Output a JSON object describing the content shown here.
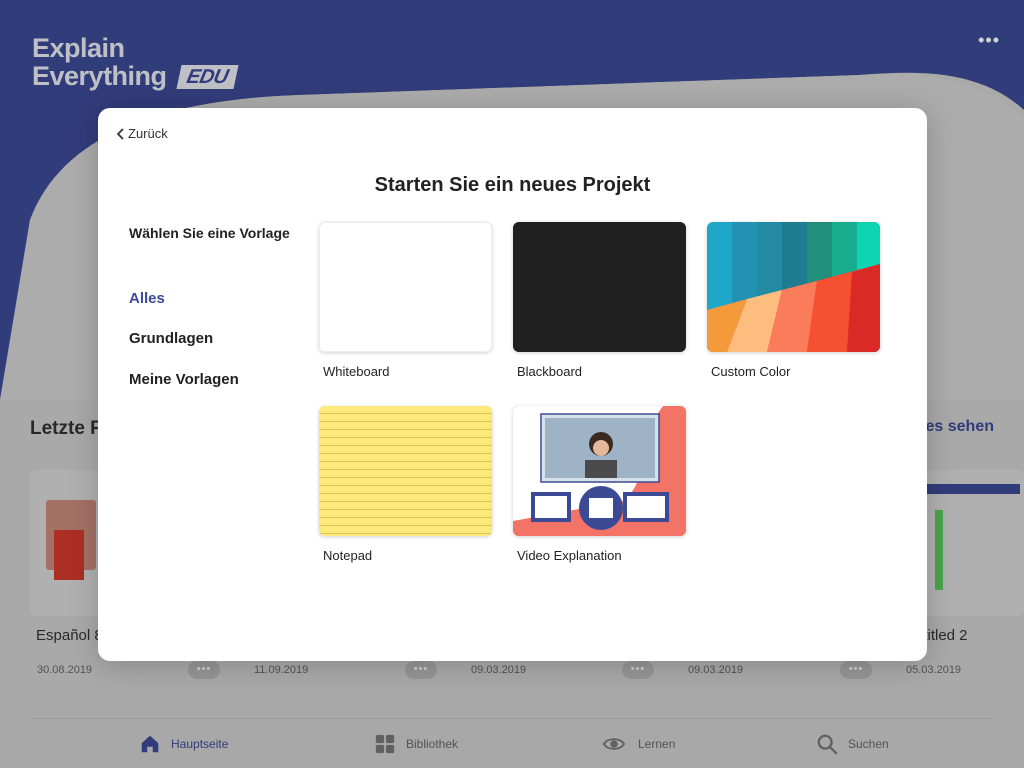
{
  "app": {
    "logo_line1": "Explain",
    "logo_line2": "Everything",
    "logo_badge": "EDU",
    "more_menu": "•••",
    "brand_color": "#3c4a95"
  },
  "recent": {
    "title": "Letzte P",
    "see_all": "es sehen",
    "projects": [
      {
        "name": "Español 8",
        "date": "30.08.2019"
      },
      {
        "name": "",
        "date": "11.09.2019"
      },
      {
        "name": "",
        "date": "09.03.2019"
      },
      {
        "name": "",
        "date": "09.03.2019"
      },
      {
        "name": "ititled 2",
        "date": "05.03.2019"
      }
    ]
  },
  "tabs": [
    {
      "label": "Hauptseite",
      "icon": "home-icon",
      "active": true
    },
    {
      "label": "Bibliothek",
      "icon": "grid-icon",
      "active": false
    },
    {
      "label": "Lernen",
      "icon": "eye-icon",
      "active": false
    },
    {
      "label": "Suchen",
      "icon": "search-icon",
      "active": false
    }
  ],
  "modal": {
    "back_label": "Zurück",
    "title": "Starten Sie ein neues Projekt",
    "side_heading": "Wählen Sie eine Vorlage",
    "categories": [
      {
        "label": "Alles",
        "active": true
      },
      {
        "label": "Grundlagen",
        "active": false
      },
      {
        "label": "Meine Vorlagen",
        "active": false
      }
    ],
    "templates": [
      {
        "label": "Whiteboard"
      },
      {
        "label": "Blackboard"
      },
      {
        "label": "Custom Color"
      },
      {
        "label": "Notepad"
      },
      {
        "label": "Video Explanation"
      }
    ]
  }
}
